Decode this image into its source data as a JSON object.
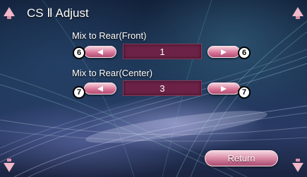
{
  "header": {
    "title": "CS Ⅱ Adjust"
  },
  "settings": [
    {
      "label": "Mix to Rear(Front)",
      "value": "1",
      "callout_dec": "6",
      "callout_inc": "6"
    },
    {
      "label": "Mix to Rear(Center)",
      "value": "3",
      "callout_dec": "7",
      "callout_inc": "7"
    }
  ],
  "footer": {
    "return_label": "Return"
  },
  "colors": {
    "button_pink": "#d9789a",
    "value_box": "#6b2246",
    "arrow_pink": "#f0b8c8"
  }
}
